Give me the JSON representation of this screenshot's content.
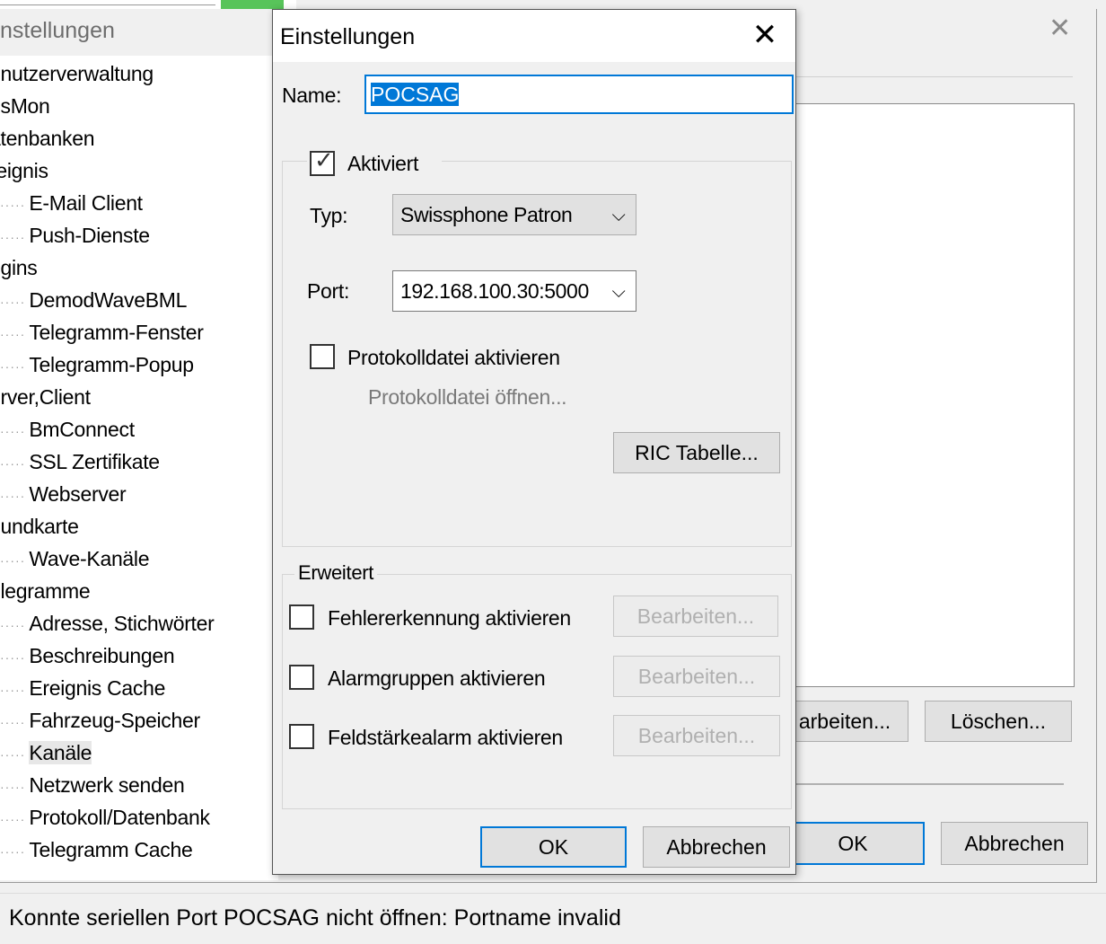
{
  "back_window": {
    "title": "nstellungen",
    "close_glyph": "✕",
    "tree_items": [
      {
        "label": "enutzerverwaltung",
        "level": 0
      },
      {
        "label": "osMon",
        "level": 0
      },
      {
        "label": "atenbanken",
        "level": 0
      },
      {
        "label": "reignis",
        "level": 0
      },
      {
        "label": "E-Mail Client",
        "level": 1
      },
      {
        "label": "Push-Dienste",
        "level": 1
      },
      {
        "label": "ugins",
        "level": 0
      },
      {
        "label": "DemodWaveBML",
        "level": 1
      },
      {
        "label": "Telegramm-Fenster",
        "level": 1
      },
      {
        "label": "Telegramm-Popup",
        "level": 1
      },
      {
        "label": "erver,Client",
        "level": 0
      },
      {
        "label": "BmConnect",
        "level": 1
      },
      {
        "label": "SSL Zertifikate",
        "level": 1
      },
      {
        "label": "Webserver",
        "level": 1
      },
      {
        "label": "oundkarte",
        "level": 0
      },
      {
        "label": "Wave-Kanäle",
        "level": 1
      },
      {
        "label": "elegramme",
        "level": 0
      },
      {
        "label": "Adresse, Stichwörter",
        "level": 1
      },
      {
        "label": "Beschreibungen",
        "level": 1
      },
      {
        "label": "Ereignis Cache",
        "level": 1
      },
      {
        "label": "Fahrzeug-Speicher",
        "level": 1
      },
      {
        "label": "Kanäle",
        "level": 1,
        "selected": true
      },
      {
        "label": "Netzwerk senden",
        "level": 1
      },
      {
        "label": "Protokoll/Datenbank",
        "level": 1
      },
      {
        "label": "Telegramm Cache",
        "level": 1
      }
    ],
    "edit_button": "arbeiten...",
    "delete_button": "Löschen...",
    "ok_button": "OK",
    "cancel_button": "Abbrechen"
  },
  "dialog": {
    "title": "Einstellungen",
    "close_glyph": "✕",
    "name_label": "Name:",
    "name_value": "POCSAG",
    "activated_label": "Aktiviert",
    "activated_checked": true,
    "type_label": "Typ:",
    "type_value": "Swissphone Patron",
    "port_label": "Port:",
    "port_value": "192.168.100.30:5000",
    "logfile_label": "Protokolldatei aktivieren",
    "logfile_checked": false,
    "logfile_open_link": "Protokolldatei öffnen...",
    "ric_button": "RIC Tabelle...",
    "extended_legend": "Erweitert",
    "extended_options": [
      {
        "label": "Fehlererkennung aktivieren",
        "checked": false,
        "button": "Bearbeiten..."
      },
      {
        "label": "Alarmgruppen aktivieren",
        "checked": false,
        "button": "Bearbeiten..."
      },
      {
        "label": "Feldstärkealarm aktivieren",
        "checked": false,
        "button": "Bearbeiten..."
      }
    ],
    "ok_button": "OK",
    "cancel_button": "Abbrechen"
  },
  "status_bar": {
    "text": "Konnte seriellen Port POCSAG nicht öffnen: Portname invalid"
  },
  "colors": {
    "accent": "#0078d7",
    "window_bg": "#f0f0f0",
    "button_bg": "#e1e1e1"
  }
}
